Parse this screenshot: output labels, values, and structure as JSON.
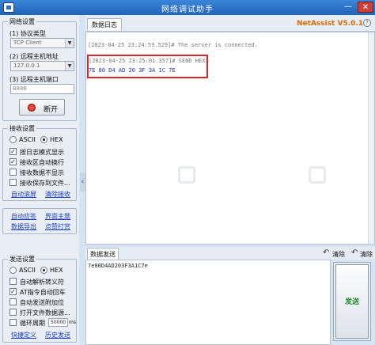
{
  "window": {
    "title": "网络调试助手",
    "minimize": "—",
    "close": "✕"
  },
  "network_settings": {
    "legend": "网络设置",
    "protocol_label": "(1) 协议类型",
    "protocol_value": "TCP Client",
    "host_label": "(2) 远程主机地址",
    "host_value": "127.0.0.1",
    "port_label": "(3) 远程主机端口",
    "port_value": "8888",
    "disconnect_label": "断开"
  },
  "receive_settings": {
    "legend": "接收设置",
    "ascii_label": "ASCII",
    "hex_label": "HEX",
    "encoding_selected": "HEX",
    "options": [
      {
        "label": "按日志模式显示",
        "checked": true
      },
      {
        "label": "接收区自动换行",
        "checked": true
      },
      {
        "label": "接收数据不显示",
        "checked": false
      },
      {
        "label": "接收保存到文件...",
        "checked": false
      }
    ],
    "auto_scroll_link": "自动滚屏",
    "clear_receive_link": "清除接收"
  },
  "tools": {
    "auto_reply": "自动应答",
    "ui_theme": "界面主题",
    "data_export": "数据导出",
    "pin_window": "点赞打赏"
  },
  "send_settings": {
    "legend": "发送设置",
    "ascii_label": "ASCII",
    "hex_label": "HEX",
    "encoding_selected": "HEX",
    "options": [
      {
        "label": "自动解析转义符",
        "checked": false
      },
      {
        "label": "AT指令自动回车",
        "checked": true
      },
      {
        "label": "自动发送附加位",
        "checked": false
      },
      {
        "label": "打开文件数据源...",
        "checked": false
      },
      {
        "label": "循环周期",
        "checked": false
      }
    ],
    "cycle_value": "50000",
    "cycle_unit": "ms",
    "quick_define_link": "快捷定义",
    "history_link": "历史发送"
  },
  "receive_panel": {
    "tab": "数据日志",
    "brand": "NetAssist V5.0.1",
    "log_line_1": "[2023-04-25 23:24:59.529]# The server is connected.",
    "log_line_2": "[2023-04-25 23:25:01.357]# SEND HEX>",
    "hex_line": "7E 80 D4 AD 20 3F 3A 1C 7E"
  },
  "send_panel": {
    "tab": "数据发送",
    "clear_label": "清除",
    "clear_label_2": "清除",
    "send_text": "7e80D4AD203F3A1C7e",
    "send_button": "发送"
  }
}
